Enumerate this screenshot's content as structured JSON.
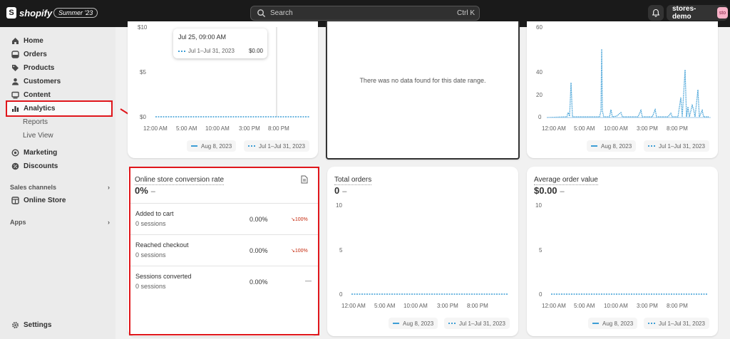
{
  "topbar": {
    "brand": "shopify",
    "badge": "Summer '23",
    "search_placeholder": "Search",
    "search_shortcut": "Ctrl K",
    "store_name": "stores-demo",
    "avatar_text": "sto"
  },
  "sidebar": {
    "items": [
      {
        "label": "Home",
        "icon": "home-icon"
      },
      {
        "label": "Orders",
        "icon": "orders-icon"
      },
      {
        "label": "Products",
        "icon": "tag-icon"
      },
      {
        "label": "Customers",
        "icon": "person-icon"
      },
      {
        "label": "Content",
        "icon": "content-icon"
      },
      {
        "label": "Analytics",
        "icon": "bar-chart-icon"
      }
    ],
    "subitems": [
      "Reports",
      "Live View"
    ],
    "items2": [
      {
        "label": "Marketing",
        "icon": "target-icon"
      },
      {
        "label": "Discounts",
        "icon": "discount-icon"
      }
    ],
    "sales_channels_label": "Sales channels",
    "online_store_label": "Online Store",
    "apps_label": "Apps",
    "settings_label": "Settings"
  },
  "top_left_card": {
    "y_ticks": [
      "$10",
      "$5",
      "$0"
    ],
    "x_ticks": [
      "12:00 AM",
      "5:00 AM",
      "10:00 AM",
      "3:00 PM",
      "8:00 PM"
    ],
    "legend": [
      "Aug 8, 2023",
      "Jul 1–Jul 31, 2023"
    ],
    "tooltip": {
      "title": "Jul 25, 09:00 AM",
      "series": "Jul 1–Jul 31, 2023",
      "value": "$0.00"
    }
  },
  "top_middle_card": {
    "no_data": "There was no data found for this date range."
  },
  "top_right_card": {
    "y_ticks": [
      "60",
      "40",
      "20",
      "0"
    ],
    "x_ticks": [
      "12:00 AM",
      "5:00 AM",
      "10:00 AM",
      "3:00 PM",
      "8:00 PM"
    ],
    "legend": [
      "Aug 8, 2023",
      "Jul 1–Jul 31, 2023"
    ]
  },
  "conversion_card": {
    "title": "Online store conversion rate",
    "value": "0%",
    "dash": "–",
    "rows": [
      {
        "label": "Added to cart",
        "sessions": "0 sessions",
        "pct": "0.00%",
        "change": "100%"
      },
      {
        "label": "Reached checkout",
        "sessions": "0 sessions",
        "pct": "0.00%",
        "change": "100%"
      },
      {
        "label": "Sessions converted",
        "sessions": "0 sessions",
        "pct": "0.00%",
        "change": "—"
      }
    ]
  },
  "orders_card": {
    "title": "Total orders",
    "value": "0",
    "dash": "–",
    "y_ticks": [
      "10",
      "5",
      "0"
    ],
    "x_ticks": [
      "12:00 AM",
      "5:00 AM",
      "10:00 AM",
      "3:00 PM",
      "8:00 PM"
    ],
    "legend": [
      "Aug 8, 2023",
      "Jul 1–Jul 31, 2023"
    ]
  },
  "aov_card": {
    "title": "Average order value",
    "value": "$0.00",
    "dash": "–",
    "y_ticks": [
      "10",
      "5",
      "0"
    ],
    "x_ticks": [
      "12:00 AM",
      "5:00 AM",
      "10:00 AM",
      "3:00 PM",
      "8:00 PM"
    ],
    "legend": [
      "Aug 8, 2023",
      "Jul 1–Jul 31, 2023"
    ]
  },
  "colors": {
    "series": "#3c9ed6",
    "annotation": "#e0161b",
    "decrease": "#c5280c"
  }
}
